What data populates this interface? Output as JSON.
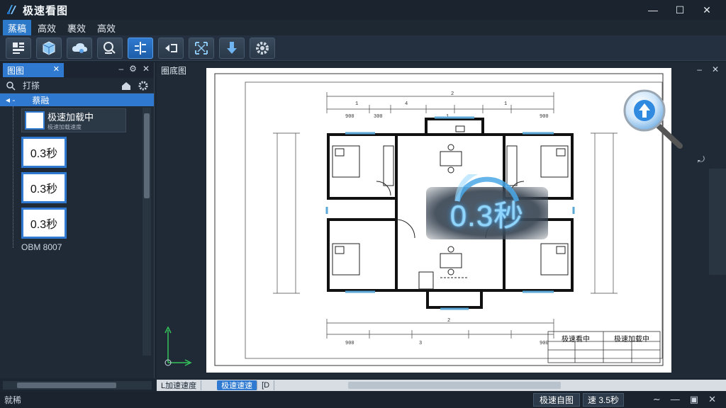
{
  "app": {
    "title": "极速看图"
  },
  "window_controls": {
    "minimize": "—",
    "maximize": "☐",
    "close": "✕"
  },
  "menu": {
    "items": [
      "蒸稿",
      "高效",
      "裹效",
      "高效"
    ]
  },
  "toolbar": {
    "buttons": [
      "layout-icon",
      "cube-icon",
      "cloud-icon",
      "measure-icon",
      "align-icon",
      "flip-icon",
      "fit-screen-icon",
      "download-icon",
      "settings-icon"
    ]
  },
  "left_panel": {
    "tab_label": "图图",
    "search_placeholder": "打搽",
    "root_label": "蔡融",
    "first_item": {
      "title": "极速加载中",
      "subtitle": "极速加载速度"
    },
    "thumbnails": [
      "0.3秒",
      "0.3秒",
      "0.3秒"
    ],
    "footer_label": "OBM 8007"
  },
  "drawing": {
    "tab_label": "圈底图",
    "load_time": "0.3秒",
    "title_block": {
      "cell_1": "极速看中",
      "cell_2": "极速加载中"
    }
  },
  "bottom_tabs": {
    "tab_1": "L加速速度",
    "tab_2": "极速速速",
    "tab_3": "[D"
  },
  "status": {
    "left": "就稀",
    "button": "极速自图",
    "value": "速 3.5秒"
  },
  "colors": {
    "accent": "#2f7ad0",
    "glow": "#8fd6ff"
  }
}
